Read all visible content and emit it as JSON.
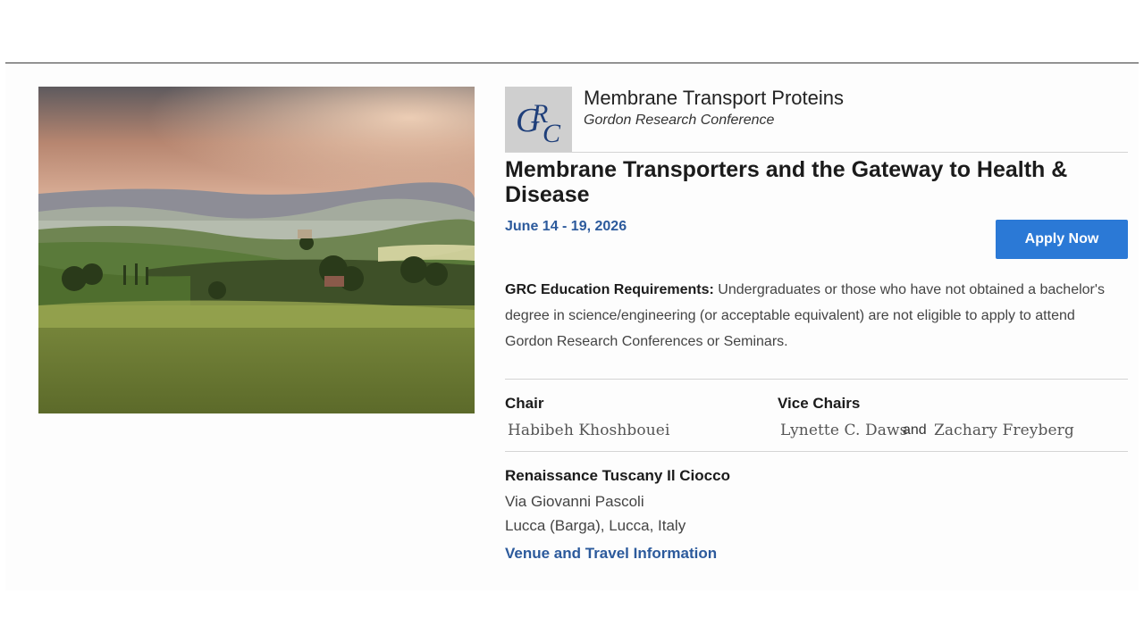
{
  "conference": {
    "series_title": "Membrane Transport Proteins",
    "series_subtitle": "Gordon Research Conference",
    "logo_text": "GRC",
    "main_title": "Membrane Transporters and the Gateway to Health & Disease",
    "dates": "June 14 - 19, 2026",
    "apply_label": "Apply Now"
  },
  "education": {
    "label": "GRC Education Requirements:",
    "text": " Undergraduates or those who have not obtained a bachelor's degree in science/engineering (or acceptable equivalent) are not eligible to apply to attend Gordon Research Conferences or Seminars."
  },
  "people": {
    "chair_label": "Chair",
    "chair_name": "Habibeh Khoshbouei",
    "vice_label": "Vice Chairs",
    "vice_1": "Lynette C. Daws",
    "and_text": "and",
    "vice_2": "Zachary Freyberg"
  },
  "venue": {
    "name": "Renaissance Tuscany Il Ciocco",
    "street": "Via Giovanni Pascoli",
    "city": "Lucca (Barga), Lucca, Italy",
    "link_label": "Venue and Travel Information"
  },
  "colors": {
    "accent_blue": "#2c5a9c",
    "button_blue": "#2b79d6",
    "logo_gray": "#cfcfcf"
  }
}
